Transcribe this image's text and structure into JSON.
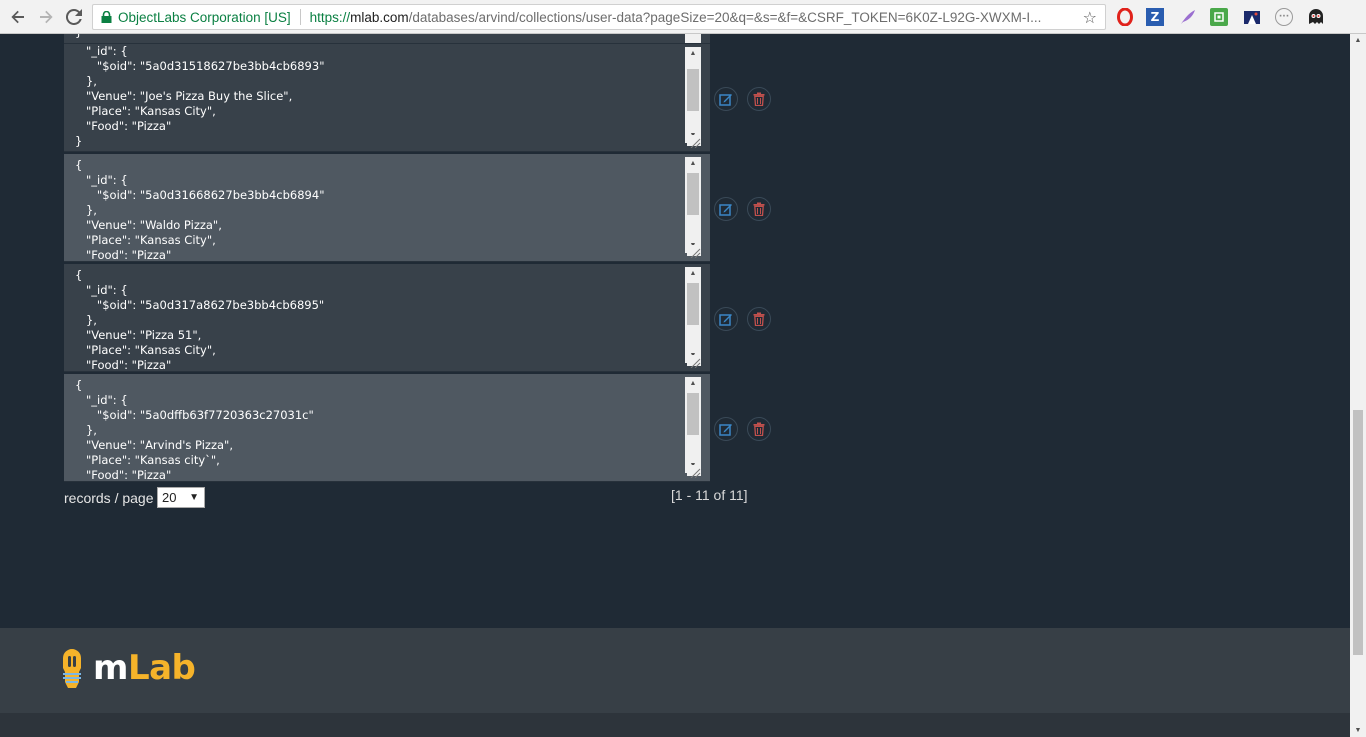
{
  "browser": {
    "site_name": "ObjectLabs Corporation [US]",
    "url_scheme": "https://",
    "url_host": "mlab.com",
    "url_rest": "/databases/arvind/collections/user-data?pageSize=20&q=&s=&f=&CSRF_TOKEN=6K0Z-L92G-XWXM-I...",
    "icons": [
      "back-icon",
      "forward-icon",
      "reload-icon",
      "lock-icon",
      "star-icon",
      "opera-icon",
      "zotero-icon",
      "feather-icon",
      "extension-icon",
      "night-mode-icon",
      "circle-extension-icon",
      "ghost-extension-icon"
    ]
  },
  "documents": [
    {
      "json": "   \"_id\": {\n      \"$oid\": \"5a0d31518627be3bb4cb6893\"\n   },\n   \"Venue\": \"Joe's Pizza Buy the Slice\",\n   \"Place\": \"Kansas City\",\n   \"Food\": \"Pizza\"\n}"
    },
    {
      "json": "{\n   \"_id\": {\n      \"$oid\": \"5a0d31668627be3bb4cb6894\"\n   },\n   \"Venue\": \"Waldo Pizza\",\n   \"Place\": \"Kansas City\",\n   \"Food\": \"Pizza\""
    },
    {
      "json": "{\n   \"_id\": {\n      \"$oid\": \"5a0d317a8627be3bb4cb6895\"\n   },\n   \"Venue\": \"Pizza 51\",\n   \"Place\": \"Kansas City\",\n   \"Food\": \"Pizza\""
    },
    {
      "json": "{\n   \"_id\": {\n      \"$oid\": \"5a0dffb63f7720363c27031c\"\n   },\n   \"Venue\": \"Arvind's Pizza\",\n   \"Place\": \"Kansas city`\",\n   \"Food\": \"Pizza\""
    }
  ],
  "pagination": {
    "records_label": "records / page",
    "page_size": "20",
    "range": "[1 - 11 of 11]"
  },
  "footer": {
    "logo_m": "m",
    "logo_lab": "Lab"
  },
  "colors": {
    "accent": "#f5b32a",
    "edit": "#3b86c6",
    "delete": "#c0504d",
    "background": "#1f2a35"
  }
}
